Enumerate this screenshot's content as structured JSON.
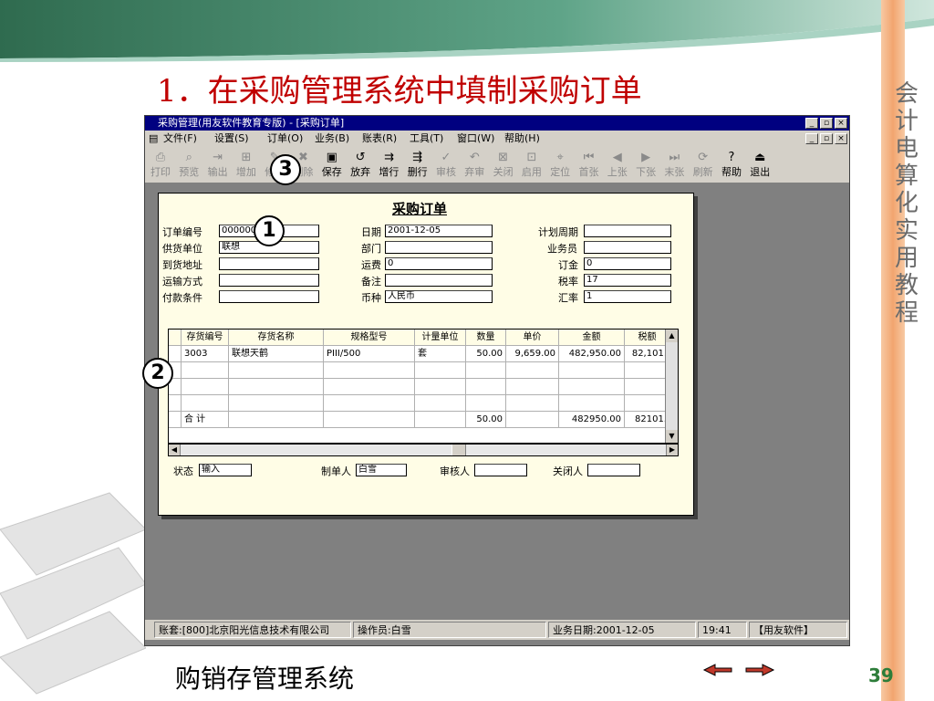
{
  "slide": {
    "title": "1．在采购管理系统中填制采购订单",
    "side_title": [
      "会",
      "计",
      "电",
      "算",
      "化",
      "实",
      "用",
      "教",
      "程"
    ],
    "bottom_title": "购销存管理系统",
    "page_number": "39",
    "callouts": [
      "1",
      "2",
      "3"
    ]
  },
  "window": {
    "title": "采购管理(用友软件教育专版) - [采购订单]",
    "buttons": {
      "min": "_",
      "max": "▫",
      "close": "×"
    },
    "menu": [
      "文件(F)",
      "设置(S)",
      "订单(O)",
      "业务(B)",
      "账表(R)",
      "工具(T)",
      "窗口(W)",
      "帮助(H)"
    ],
    "toolbar": [
      {
        "label": "打印",
        "icon": "printer-icon",
        "enabled": false
      },
      {
        "label": "预览",
        "icon": "preview-icon",
        "enabled": false
      },
      {
        "label": "输出",
        "icon": "export-icon",
        "enabled": false
      },
      {
        "label": "增加",
        "icon": "add-icon",
        "enabled": false
      },
      {
        "label": "修改",
        "icon": "edit-icon",
        "enabled": false
      },
      {
        "label": "删除",
        "icon": "delete-icon",
        "enabled": false
      },
      {
        "label": "保存",
        "icon": "save-icon",
        "enabled": true
      },
      {
        "label": "放弃",
        "icon": "discard-icon",
        "enabled": true
      },
      {
        "label": "增行",
        "icon": "add-row-icon",
        "enabled": true
      },
      {
        "label": "删行",
        "icon": "delete-row-icon",
        "enabled": true
      },
      {
        "label": "审核",
        "icon": "approve-icon",
        "enabled": false
      },
      {
        "label": "弃审",
        "icon": "unapprove-icon",
        "enabled": false
      },
      {
        "label": "关闭",
        "icon": "close-doc-icon",
        "enabled": false
      },
      {
        "label": "启用",
        "icon": "enable-icon",
        "enabled": false
      },
      {
        "label": "定位",
        "icon": "locate-icon",
        "enabled": false
      },
      {
        "label": "首张",
        "icon": "first-icon",
        "enabled": false
      },
      {
        "label": "上张",
        "icon": "prev-icon",
        "enabled": false
      },
      {
        "label": "下张",
        "icon": "next-icon",
        "enabled": false
      },
      {
        "label": "末张",
        "icon": "last-icon",
        "enabled": false
      },
      {
        "label": "刷新",
        "icon": "refresh-icon",
        "enabled": false
      },
      {
        "label": "帮助",
        "icon": "help-icon",
        "enabled": true
      },
      {
        "label": "退出",
        "icon": "exit-icon",
        "enabled": true
      }
    ]
  },
  "form": {
    "title": "采购订单",
    "fields_left": [
      {
        "label": "订单编号",
        "value": "0000000"
      },
      {
        "label": "供货单位",
        "value": "联想"
      },
      {
        "label": "到货地址",
        "value": ""
      },
      {
        "label": "运输方式",
        "value": ""
      },
      {
        "label": "付款条件",
        "value": ""
      }
    ],
    "fields_mid": [
      {
        "label": "日期",
        "value": "2001-12-05"
      },
      {
        "label": "部门",
        "value": ""
      },
      {
        "label": "运费",
        "value": "0"
      },
      {
        "label": "备注",
        "value": ""
      },
      {
        "label": "币种",
        "value": "人民币"
      }
    ],
    "fields_right": [
      {
        "label": "计划周期",
        "value": ""
      },
      {
        "label": "业务员",
        "value": ""
      },
      {
        "label": "订金",
        "value": "0"
      },
      {
        "label": "税率",
        "value": "17"
      },
      {
        "label": "汇率",
        "value": "1"
      }
    ],
    "grid": {
      "columns": [
        "存货编号",
        "存货名称",
        "规格型号",
        "计量单位",
        "数量",
        "单价",
        "金额",
        "税额"
      ],
      "rows": [
        [
          "3003",
          "联想天鹤",
          "PIII/500",
          "套",
          "50.00",
          "9,659.00",
          "482,950.00",
          "82,101."
        ],
        [
          "",
          "",
          "",
          "",
          "",
          "",
          "",
          ""
        ],
        [
          "",
          "",
          "",
          "",
          "",
          "",
          "",
          ""
        ],
        [
          "",
          "",
          "",
          "",
          "",
          "",
          "",
          ""
        ]
      ],
      "total": {
        "label": "合  计",
        "qty": "50.00",
        "amount": "482950.00",
        "tax": "82101."
      }
    },
    "footer": [
      {
        "label": "状态",
        "value": "输入"
      },
      {
        "label": "制单人",
        "value": "白雪"
      },
      {
        "label": "审核人",
        "value": ""
      },
      {
        "label": "关闭人",
        "value": ""
      }
    ]
  },
  "statusbar": [
    "账套:[800]北京阳光信息技术有限公司",
    "操作员:白雪",
    "业务日期:2001-12-05",
    "19:41",
    "【用友软件】"
  ]
}
